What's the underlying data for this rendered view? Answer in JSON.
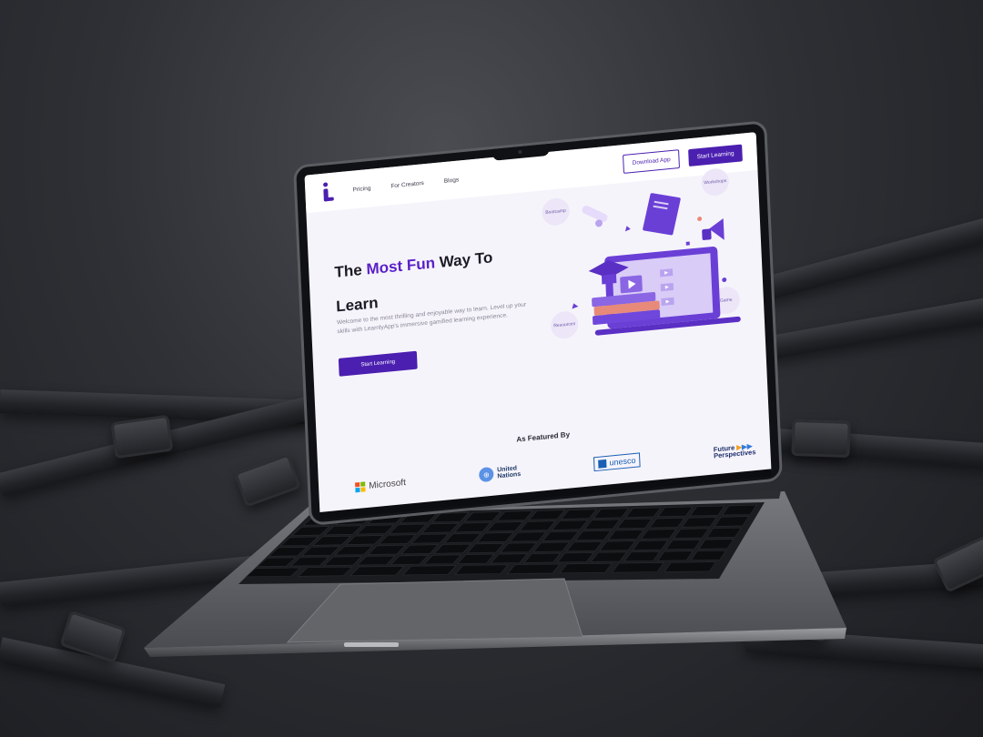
{
  "nav": {
    "links": [
      "Pricing",
      "For Creators",
      "Blogs"
    ],
    "download_label": "Download App",
    "start_label": "Start Learning"
  },
  "hero": {
    "title_part1": "The ",
    "title_accent": "Most Fun",
    "title_part2": " Way To",
    "title_line2": "Learn",
    "description": "Welcome to the most thrilling and enjoyable way to learn. Level up your skills with LearnlyApp's immersive gamified learning experience.",
    "cta_label": "Start Learning"
  },
  "illustration": {
    "bubbles": [
      "Bootcamp",
      "Workshops",
      "Resources",
      "Game"
    ]
  },
  "featured": {
    "heading": "As Featured By",
    "partners": {
      "microsoft": "Microsoft",
      "un_line1": "United",
      "un_line2": "Nations",
      "unesco": "unesco",
      "fp_line1": "Future",
      "fp_line2": "Perspectives"
    }
  },
  "colors": {
    "accent": "#4b1fb0",
    "accent_text": "#5a20c8",
    "background_dark": "#2a2c31"
  }
}
